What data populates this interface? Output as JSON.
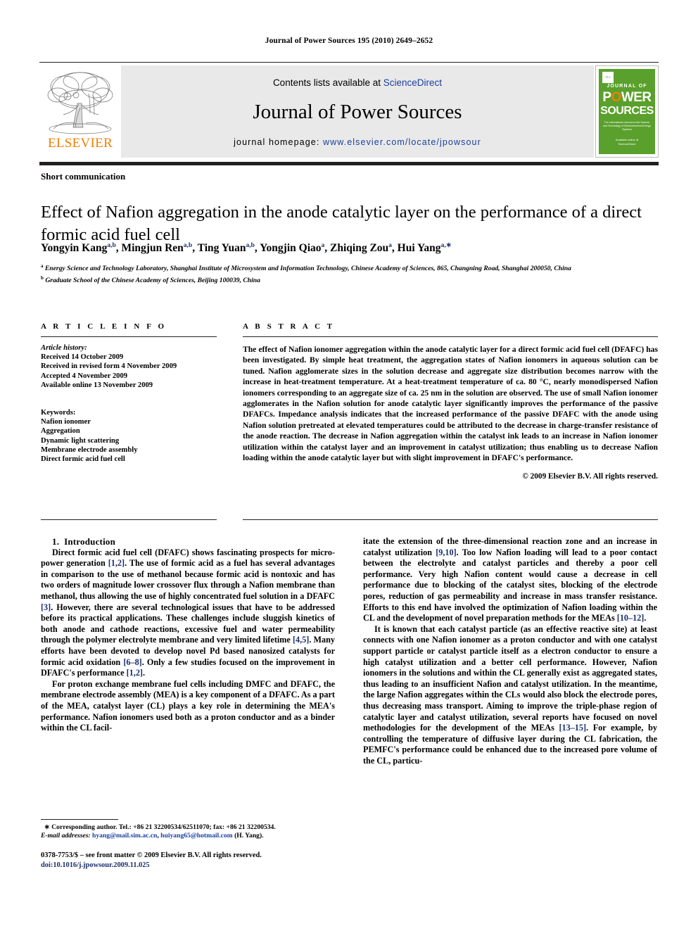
{
  "running_head": "Journal of Power Sources 195 (2010) 2649–2652",
  "masthead": {
    "publisher_name": "ELSEVIER",
    "contents_line_prefix": "Contents lists available at ",
    "contents_link": "ScienceDirect",
    "journal_title": "Journal of Power Sources",
    "homepage_label": "journal homepage:",
    "homepage_url": "www.elsevier.com/locate/jpowsour",
    "cover": {
      "line_journal_of": "JOURNAL OF",
      "line_power": "POWER",
      "line_sources": "SOURCES",
      "subtitle": "The International Journal on the Science and Technology of Electrochemical Energy Systems",
      "sciencedirect": "Available online at ScienceDirect",
      "background_color": "#5aa02c",
      "accent_color": "#f08000"
    }
  },
  "article": {
    "kind": "Short communication",
    "title": "Effect of Nafion aggregation in the anode catalytic layer on the performance of a direct formic acid fuel cell",
    "authors_html": "Yongyin Kang<sup>a,b</sup>, Mingjun Ren<sup>a,b</sup>, Ting Yuan<sup>a,b</sup>, Yongjin Qiao<sup>a</sup>, Zhiqing Zou<sup>a</sup>, Hui Yang<sup>a,</sup><sup>∗</sup>",
    "affiliation_a": "Energy Science and Technology Laboratory, Shanghai Institute of Microsystem and Information Technology, Chinese Academy of Sciences, 865, Changning Road, Shanghai 200050, China",
    "affiliation_b": "Graduate School of the Chinese Academy of Sciences, Beijing 100039, China"
  },
  "article_info": {
    "heading": "A R T I C L E   I N F O",
    "history_label": "Article history:",
    "history": [
      "Received 14 October 2009",
      "Received in revised form 4 November 2009",
      "Accepted 4 November 2009",
      "Available online 13 November 2009"
    ],
    "keywords_label": "Keywords:",
    "keywords": [
      "Nafion ionomer",
      "Aggregation",
      "Dynamic light scattering",
      "Membrane electrode assembly",
      "Direct formic acid fuel cell"
    ]
  },
  "abstract": {
    "heading": "A B S T R A C T",
    "text": "The effect of Nafion ionomer aggregation within the anode catalytic layer for a direct formic acid fuel cell (DFAFC) has been investigated. By simple heat treatment, the aggregation states of Nafion ionomers in aqueous solution can be tuned. Nafion agglomerate sizes in the solution decrease and aggregate size distribution becomes narrow with the increase in heat-treatment temperature. At a heat-treatment temperature of ca. 80 °C, nearly monodispersed Nafion ionomers corresponding to an aggregate size of ca. 25 nm in the solution are observed. The use of small Nafion ionomer agglomerates in the Nafion solution for anode catalytic layer significantly improves the performance of the passive DFAFCs. Impedance analysis indicates that the increased performance of the passive DFAFC with the anode using Nafion solution pretreated at elevated temperatures could be attributed to the decrease in charge-transfer resistance of the anode reaction. The decrease in Nafion aggregation within the catalyst ink leads to an increase in Nafion ionomer utilization within the catalyst layer and an improvement in catalyst utilization; thus enabling us to decrease Nafion loading within the anode catalytic layer but with slight improvement in DFAFC's performance.",
    "copyright": "© 2009 Elsevier B.V. All rights reserved."
  },
  "body": {
    "section_number": "1.",
    "section_title": "Introduction",
    "left_paragraphs": [
      "Direct formic acid fuel cell (DFAFC) shows fascinating prospects for micro-power generation [1,2]. The use of formic acid as a fuel has several advantages in comparison to the use of methanol because formic acid is nontoxic and has two orders of magnitude lower crossover flux through a Nafion membrane than methanol, thus allowing the use of highly concentrated fuel solution in a DFAFC [3]. However, there are several technological issues that have to be addressed before its practical applications. These challenges include sluggish kinetics of both anode and cathode reactions, excessive fuel and water permeability through the polymer electrolyte membrane and very limited lifetime [4,5]. Many efforts have been devoted to develop novel Pd based nanosized catalysts for formic acid oxidation [6–8]. Only a few studies focused on the improvement in DFAFC's performance [1,2].",
      "For proton exchange membrane fuel cells including DMFC and DFAFC, the membrane electrode assembly (MEA) is a key component of a DFAFC. As a part of the MEA, catalyst layer (CL) plays a key role in determining the MEA's performance. Nafion ionomers used both as a proton conductor and as a binder within the CL facil-"
    ],
    "right_paragraphs": [
      "itate the extension of the three-dimensional reaction zone and an increase in catalyst utilization [9,10]. Too low Nafion loading will lead to a poor contact between the electrolyte and catalyst particles and thereby a poor cell performance. Very high Nafion content would cause a decrease in cell performance due to blocking of the catalyst sites, blocking of the electrode pores, reduction of gas permeability and increase in mass transfer resistance. Efforts to this end have involved the optimization of Nafion loading within the CL and the development of novel preparation methods for the MEAs [10–12].",
      "It is known that each catalyst particle (as an effective reactive site) at least connects with one Nafion ionomer as a proton conductor and with one catalyst support particle or catalyst particle itself as a electron conductor to ensure a high catalyst utilization and a better cell performance. However, Nafion ionomers in the solutions and within the CL generally exist as aggregated states, thus leading to an insufficient Nafion and catalyst utilization. In the meantime, the large Nafion aggregates within the CLs would also block the electrode pores, thus decreasing mass transport. Aiming to improve the triple-phase region of catalytic layer and catalyst utilization, several reports have focused on novel methodologies for the development of the MEAs [13–15]. For example, by controlling the temperature of diffusive layer during the CL fabrication, the PEMFC's performance could be enhanced due to the increased pore volume of the CL, particu-"
    ]
  },
  "footnote": {
    "marker": "∗",
    "corresponding": "Corresponding author. Tel.: +86 21 32200534/62511070; fax: +86 21 32200534.",
    "email_label": "E-mail addresses:",
    "email1": "hyang@mail.sim.ac.cn",
    "email2": "huiyang65@hotmail.com",
    "email_suffix": "(H. Yang)."
  },
  "imprint": {
    "issn_line": "0378-7753/$ – see front matter © 2009 Elsevier B.V. All rights reserved.",
    "doi_label": "doi:",
    "doi_value": "10.1016/j.jpowsour.2009.11.025"
  }
}
